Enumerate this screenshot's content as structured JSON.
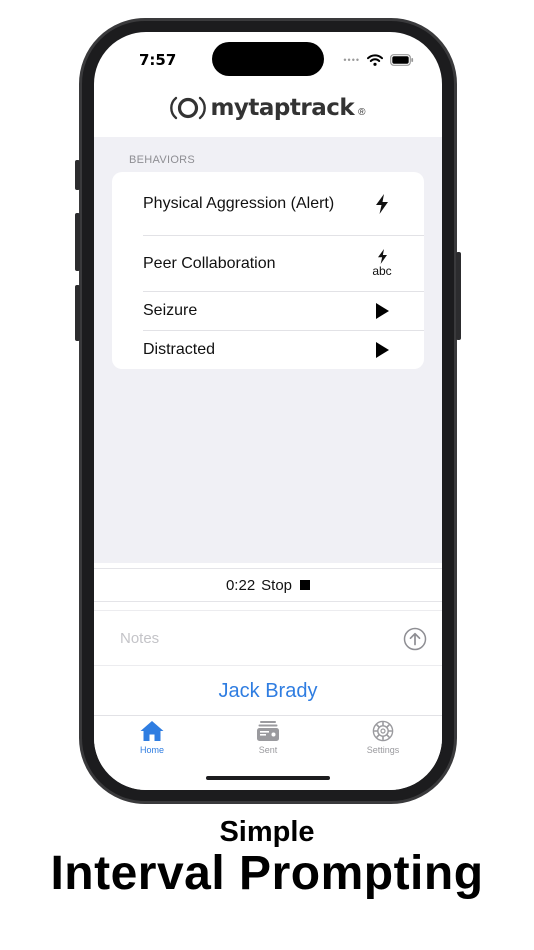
{
  "status_bar": {
    "time": "7:57"
  },
  "app": {
    "logo_text": "mytaptrack",
    "logo_mark": "®"
  },
  "behaviors": {
    "section_label": "BEHAVIORS",
    "items": [
      {
        "label": "Physical Aggression (Alert)",
        "icon": "bolt-icon",
        "sublabel": ""
      },
      {
        "label": "Peer Collaboration",
        "icon": "bolt-icon",
        "sublabel": "abc"
      },
      {
        "label": "Seizure",
        "icon": "play-icon",
        "sublabel": ""
      },
      {
        "label": "Distracted",
        "icon": "play-icon",
        "sublabel": ""
      }
    ]
  },
  "timer": {
    "elapsed": "0:22",
    "stop_label": "Stop"
  },
  "notes": {
    "placeholder": "Notes",
    "value": ""
  },
  "student": {
    "name": "Jack Brady"
  },
  "tabs": [
    {
      "label": "Home",
      "icon": "house-icon",
      "active": true
    },
    {
      "label": "Sent",
      "icon": "tray-icon",
      "active": false
    },
    {
      "label": "Settings",
      "icon": "gear-icon",
      "active": false
    }
  ],
  "caption": {
    "line1": "Simple",
    "line2": "Interval Prompting"
  },
  "colors": {
    "accent": "#2f7de1",
    "background": "#f0f0f5",
    "phone_frame": "#1c1c1e"
  }
}
